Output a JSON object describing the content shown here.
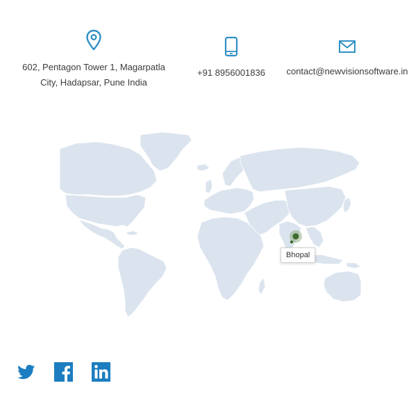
{
  "contact": {
    "address": "602, Pentagon Tower 1, Magarpatla\nCity, Hadapsar, Pune India",
    "phone": "+91 8956001836",
    "email": "contact@newvisionsoftware.in"
  },
  "map": {
    "marker_label": "Bhopal"
  },
  "icons": {
    "address": "location-pin-icon",
    "phone": "mobile-phone-icon",
    "email": "envelope-icon",
    "twitter": "twitter-icon",
    "facebook": "facebook-icon",
    "linkedin": "linkedin-icon"
  },
  "colors": {
    "accent": "#2f8fc4",
    "social": "#1c7dc0",
    "land": "#dbe4ee",
    "border": "#ffffff",
    "marker": "#3f6b2e",
    "text": "#3b3b3b"
  }
}
